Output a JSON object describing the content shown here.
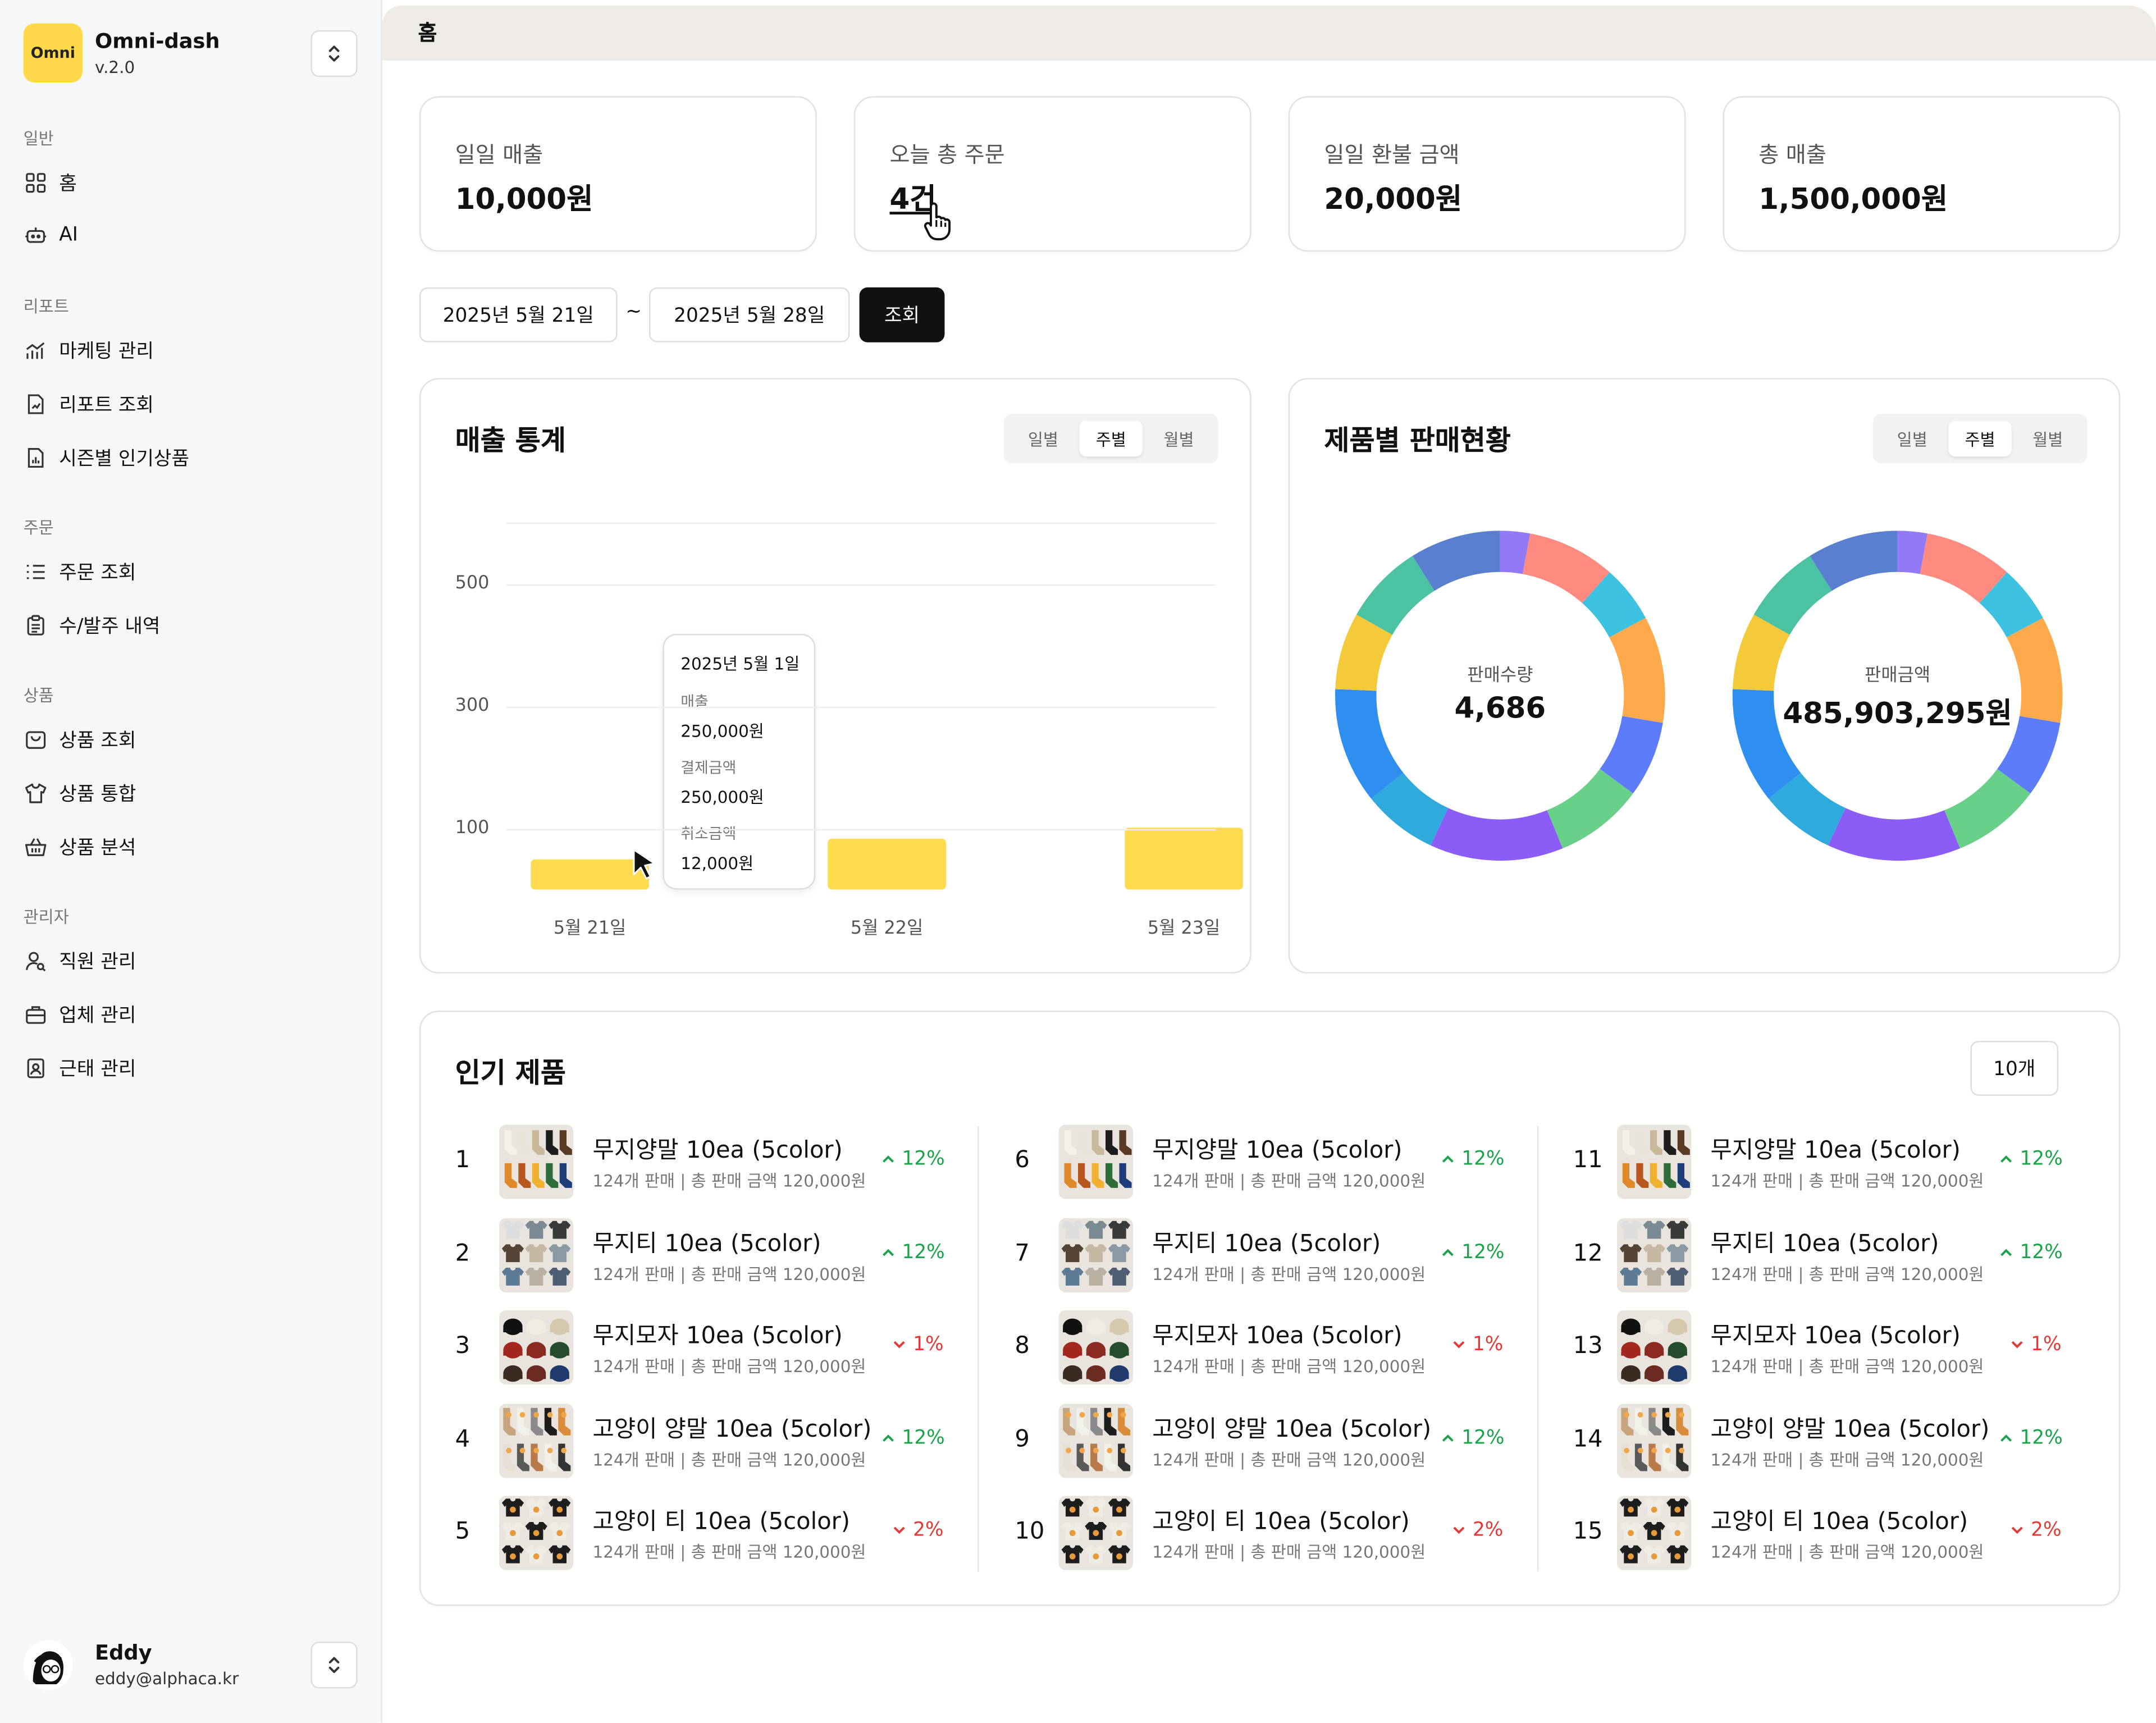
{
  "app": {
    "name": "Omni-dash",
    "version": "v.2.0",
    "logo_text": "Omni"
  },
  "sidebar": {
    "sections": [
      {
        "label": "일반",
        "items": [
          {
            "label": "홈",
            "icon": "grid-icon"
          },
          {
            "label": "AI",
            "icon": "robot-icon"
          }
        ]
      },
      {
        "label": "리포트",
        "items": [
          {
            "label": "마케팅 관리",
            "icon": "chart-icon"
          },
          {
            "label": "리포트 조회",
            "icon": "file-chart-icon"
          },
          {
            "label": "시즌별 인기상품",
            "icon": "file-stats-icon"
          }
        ]
      },
      {
        "label": "주문",
        "items": [
          {
            "label": "주문 조회",
            "icon": "list-icon"
          },
          {
            "label": "수/발주 내역",
            "icon": "clipboard-icon"
          }
        ]
      },
      {
        "label": "상품",
        "items": [
          {
            "label": "상품 조회",
            "icon": "box-icon"
          },
          {
            "label": "상품 통합",
            "icon": "shirt-icon"
          },
          {
            "label": "상품 분석",
            "icon": "basket-icon"
          }
        ]
      },
      {
        "label": "관리자",
        "items": [
          {
            "label": "직원 관리",
            "icon": "user-search-icon"
          },
          {
            "label": "업체 관리",
            "icon": "briefcase-icon"
          },
          {
            "label": "근태 관리",
            "icon": "badge-icon"
          }
        ]
      }
    ],
    "user": {
      "name": "Eddy",
      "email": "eddy@alphaca.kr"
    }
  },
  "header": {
    "title": "홈"
  },
  "kpis": [
    {
      "label": "일일 매출",
      "value": "10,000원"
    },
    {
      "label": "오늘 총 주문",
      "value": "4건"
    },
    {
      "label": "일일 환불 금액",
      "value": "20,000원"
    },
    {
      "label": "총 매출",
      "value": "1,500,000원"
    }
  ],
  "filter": {
    "start_date": "2025년 5월 21일",
    "separator": "~",
    "end_date": "2025년 5월 28일",
    "query_label": "조회"
  },
  "sales_chart": {
    "title": "매출 통계",
    "tabs": [
      "일별",
      "주별",
      "월별"
    ],
    "active_tab": "주별",
    "tooltip": {
      "date": "2025년 5월 1일",
      "rows": [
        {
          "label": "매출",
          "value": "250,000원"
        },
        {
          "label": "결제금액",
          "value": "250,000원"
        },
        {
          "label": "취소금액",
          "value": "12,000원"
        }
      ]
    }
  },
  "chart_data": {
    "type": "bar",
    "categories": [
      "5월 21일",
      "5월 22일",
      "5월 23일"
    ],
    "values": [
      50,
      84,
      102
    ],
    "yticks": [
      "500",
      "300",
      "100"
    ],
    "ytick_values": [
      500,
      300,
      100
    ],
    "ylim": [
      0,
      600
    ],
    "grid": true,
    "color": "#ffdb4d"
  },
  "product_sales": {
    "title": "제품별 판매현황",
    "tabs": [
      "일별",
      "주별",
      "월별"
    ],
    "active_tab": "주별",
    "donuts": [
      {
        "label": "판매수량",
        "value": "4,686"
      },
      {
        "label": "판매금액",
        "value": "485,903,295원"
      }
    ],
    "segment_colors": [
      "#9279f5",
      "#ff8a80",
      "#3cc1e0",
      "#ffa94d",
      "#5c7cfa",
      "#69d08a",
      "#8b5cf6",
      "#2eaadc",
      "#2e8ff0",
      "#f4ca3a",
      "#4bc3a3",
      "#5b7fcf"
    ],
    "segment_shares": [
      3.2,
      9.5,
      6.2,
      11.5,
      8.2,
      9.6,
      14.4,
      8.1,
      12.5,
      8.3,
      8.7,
      9.8
    ]
  },
  "popular": {
    "title": "인기 제품",
    "count_label": "10개",
    "items": [
      {
        "rank": "1",
        "name": "무지양말 10ea (5color)",
        "sub": "124개 판매 | 총 판매 금액 120,000원",
        "delta": "12%",
        "dir": "up",
        "thumb": "socks"
      },
      {
        "rank": "2",
        "name": "무지티 10ea (5color)",
        "sub": "124개 판매 | 총 판매 금액 120,000원",
        "delta": "12%",
        "dir": "up",
        "thumb": "tshirts"
      },
      {
        "rank": "3",
        "name": "무지모자 10ea (5color)",
        "sub": "124개 판매 | 총 판매 금액 120,000원",
        "delta": "1%",
        "dir": "down",
        "thumb": "caps"
      },
      {
        "rank": "4",
        "name": "고양이 양말 10ea (5color)",
        "sub": "124개 판매 | 총 판매 금액 120,000원",
        "delta": "12%",
        "dir": "up",
        "thumb": "catsocks"
      },
      {
        "rank": "5",
        "name": "고양이 티 10ea (5color)",
        "sub": "124개 판매 | 총 판매 금액 120,000원",
        "delta": "2%",
        "dir": "down",
        "thumb": "cattees"
      },
      {
        "rank": "6",
        "name": "무지양말 10ea (5color)",
        "sub": "124개 판매 | 총 판매 금액 120,000원",
        "delta": "12%",
        "dir": "up",
        "thumb": "socks"
      },
      {
        "rank": "7",
        "name": "무지티 10ea (5color)",
        "sub": "124개 판매 | 총 판매 금액 120,000원",
        "delta": "12%",
        "dir": "up",
        "thumb": "tshirts"
      },
      {
        "rank": "8",
        "name": "무지모자 10ea (5color)",
        "sub": "124개 판매 | 총 판매 금액 120,000원",
        "delta": "1%",
        "dir": "down",
        "thumb": "caps"
      },
      {
        "rank": "9",
        "name": "고양이 양말 10ea (5color)",
        "sub": "124개 판매 | 총 판매 금액 120,000원",
        "delta": "12%",
        "dir": "up",
        "thumb": "catsocks"
      },
      {
        "rank": "10",
        "name": "고양이 티 10ea (5color)",
        "sub": "124개 판매 | 총 판매 금액 120,000원",
        "delta": "2%",
        "dir": "down",
        "thumb": "cattees"
      },
      {
        "rank": "11",
        "name": "무지양말 10ea (5color)",
        "sub": "124개 판매 | 총 판매 금액 120,000원",
        "delta": "12%",
        "dir": "up",
        "thumb": "socks"
      },
      {
        "rank": "12",
        "name": "무지티 10ea (5color)",
        "sub": "124개 판매 | 총 판매 금액 120,000원",
        "delta": "12%",
        "dir": "up",
        "thumb": "tshirts"
      },
      {
        "rank": "13",
        "name": "무지모자 10ea (5color)",
        "sub": "124개 판매 | 총 판매 금액 120,000원",
        "delta": "1%",
        "dir": "down",
        "thumb": "caps"
      },
      {
        "rank": "14",
        "name": "고양이 양말 10ea (5color)",
        "sub": "124개 판매 | 총 판매 금액 120,000원",
        "delta": "12%",
        "dir": "up",
        "thumb": "catsocks"
      },
      {
        "rank": "15",
        "name": "고양이 티 10ea (5color)",
        "sub": "124개 판매 | 총 판매 금액 120,000원",
        "delta": "2%",
        "dir": "down",
        "thumb": "cattees"
      }
    ]
  },
  "colors": {
    "accent": "#ffd94a",
    "bar": "#ffdb4d",
    "up": "#1aa34a",
    "down": "#e53935",
    "header_bg": "#eeebe6"
  }
}
